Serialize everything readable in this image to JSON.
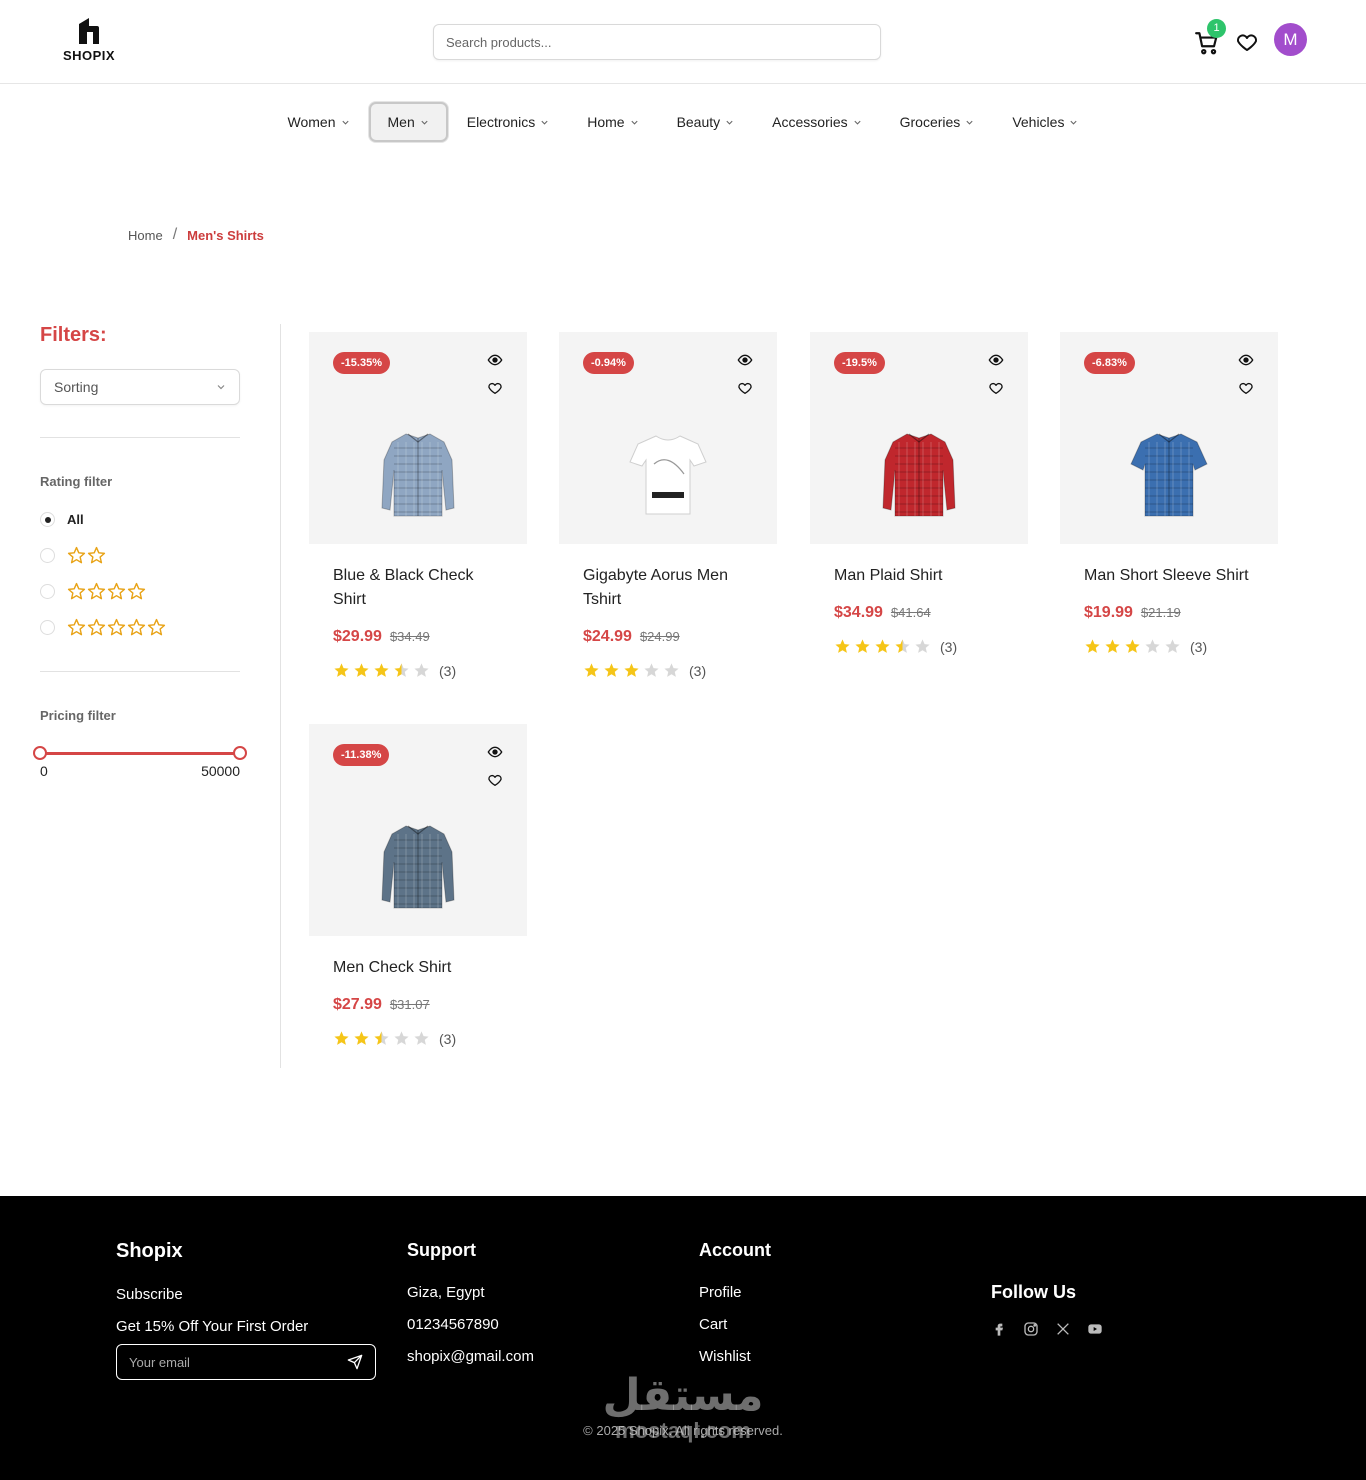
{
  "header": {
    "logo_text": "SHOPIX",
    "search_placeholder": "Search products...",
    "cart_count": "1",
    "avatar_initial": "M"
  },
  "nav": {
    "items": [
      {
        "label": "Women"
      },
      {
        "label": "Men"
      },
      {
        "label": "Electronics"
      },
      {
        "label": "Home"
      },
      {
        "label": "Beauty"
      },
      {
        "label": "Accessories"
      },
      {
        "label": "Groceries"
      },
      {
        "label": "Vehicles"
      }
    ],
    "active": "Men"
  },
  "breadcrumb": {
    "home": "Home",
    "separator": "/",
    "current": "Men's Shirts"
  },
  "sidebar": {
    "title": "Filters:",
    "sorting_label": "Sorting",
    "rating_filter_label": "Rating filter",
    "rating_options": [
      {
        "label": "All",
        "stars": 0,
        "selected": true
      },
      {
        "label": "",
        "stars": 2,
        "selected": false
      },
      {
        "label": "",
        "stars": 4,
        "selected": false
      },
      {
        "label": "",
        "stars": 5,
        "selected": false
      }
    ],
    "pricing_filter_label": "Pricing filter",
    "price_min": "0",
    "price_max": "50000"
  },
  "products": [
    {
      "title": "Blue & Black Check Shirt",
      "discount": "-15.35%",
      "price": "$29.99",
      "old_price": "$34.49",
      "rating": 3.5,
      "reviews": "(3)",
      "shirt_color": "#8fa6c2",
      "shirt_type": "long"
    },
    {
      "title": "Gigabyte Aorus Men Tshirt",
      "discount": "-0.94%",
      "price": "$24.99",
      "old_price": "$24.99",
      "rating": 3,
      "reviews": "(3)",
      "shirt_color": "#ffffff",
      "shirt_type": "tee"
    },
    {
      "title": "Man Plaid Shirt",
      "discount": "-19.5%",
      "price": "$34.99",
      "old_price": "$41.64",
      "rating": 3.5,
      "reviews": "(3)",
      "shirt_color": "#c0272d",
      "shirt_type": "long"
    },
    {
      "title": "Man Short Sleeve Shirt",
      "discount": "-6.83%",
      "price": "$19.99",
      "old_price": "$21.19",
      "rating": 3,
      "reviews": "(3)",
      "shirt_color": "#3b6fb0",
      "shirt_type": "short"
    },
    {
      "title": "Men Check Shirt",
      "discount": "-11.38%",
      "price": "$27.99",
      "old_price": "$31.07",
      "rating": 2.5,
      "reviews": "(3)",
      "shirt_color": "#5d7388",
      "shirt_type": "long"
    }
  ],
  "footer": {
    "brand": "Shopix",
    "subscribe": "Subscribe",
    "offer": "Get 15% Off Your First Order",
    "email_placeholder": "Your email",
    "support_title": "Support",
    "support_items": [
      "Giza, Egypt",
      "01234567890",
      "shopix@gmail.com"
    ],
    "account_title": "Account",
    "account_items": [
      "Profile",
      "Cart",
      "Wishlist"
    ],
    "follow_title": "Follow Us",
    "copyright": "© 2025 Shopix. All rights reserved.",
    "watermark_ar": "مستقل",
    "watermark_lat": "mostaql.com"
  },
  "colors": {
    "accent": "#d54646",
    "star": "#f5c518",
    "star_outline": "#e8a317",
    "badge_green": "#2ec46b",
    "avatar": "#a24dcc"
  }
}
